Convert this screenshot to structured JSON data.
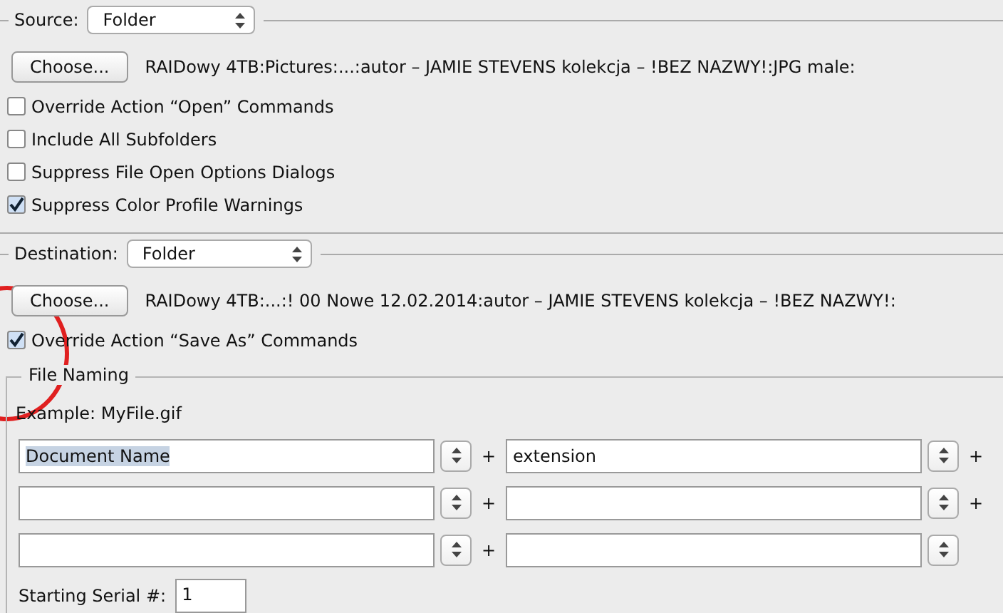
{
  "source": {
    "label": "Source:",
    "select": "Folder",
    "choose_button": "Choose...",
    "path": "RAIDowy 4TB:Pictures:...:autor – JAMIE STEVENS kolekcja – !BEZ NAZWY!:JPG male:",
    "options": [
      {
        "label": "Override Action “Open” Commands",
        "checked": false
      },
      {
        "label": "Include All Subfolders",
        "checked": false
      },
      {
        "label": "Suppress File Open Options Dialogs",
        "checked": false
      },
      {
        "label": "Suppress Color Profile Warnings",
        "checked": true
      }
    ]
  },
  "destination": {
    "label": "Destination:",
    "select": "Folder",
    "choose_button": "Choose...",
    "path": "RAIDowy 4TB:...:! 00 Nowe 12.02.2014:autor – JAMIE STEVENS kolekcja – !BEZ NAZWY!:",
    "options": [
      {
        "label": "Override Action “Save As” Commands",
        "checked": true
      }
    ]
  },
  "file_naming": {
    "title": "File Naming",
    "example": "Example: MyFile.gif",
    "rows": [
      {
        "fields": [
          {
            "value": "Document Name",
            "highlighted": true
          },
          {
            "value": "extension",
            "highlighted": false
          }
        ],
        "joiners": [
          "+",
          "+"
        ]
      },
      {
        "joiners": [
          "+",
          "+"
        ]
      },
      {
        "joiners": [
          "+"
        ]
      }
    ],
    "serial_label": "Starting Serial #:",
    "serial_value": "1"
  }
}
